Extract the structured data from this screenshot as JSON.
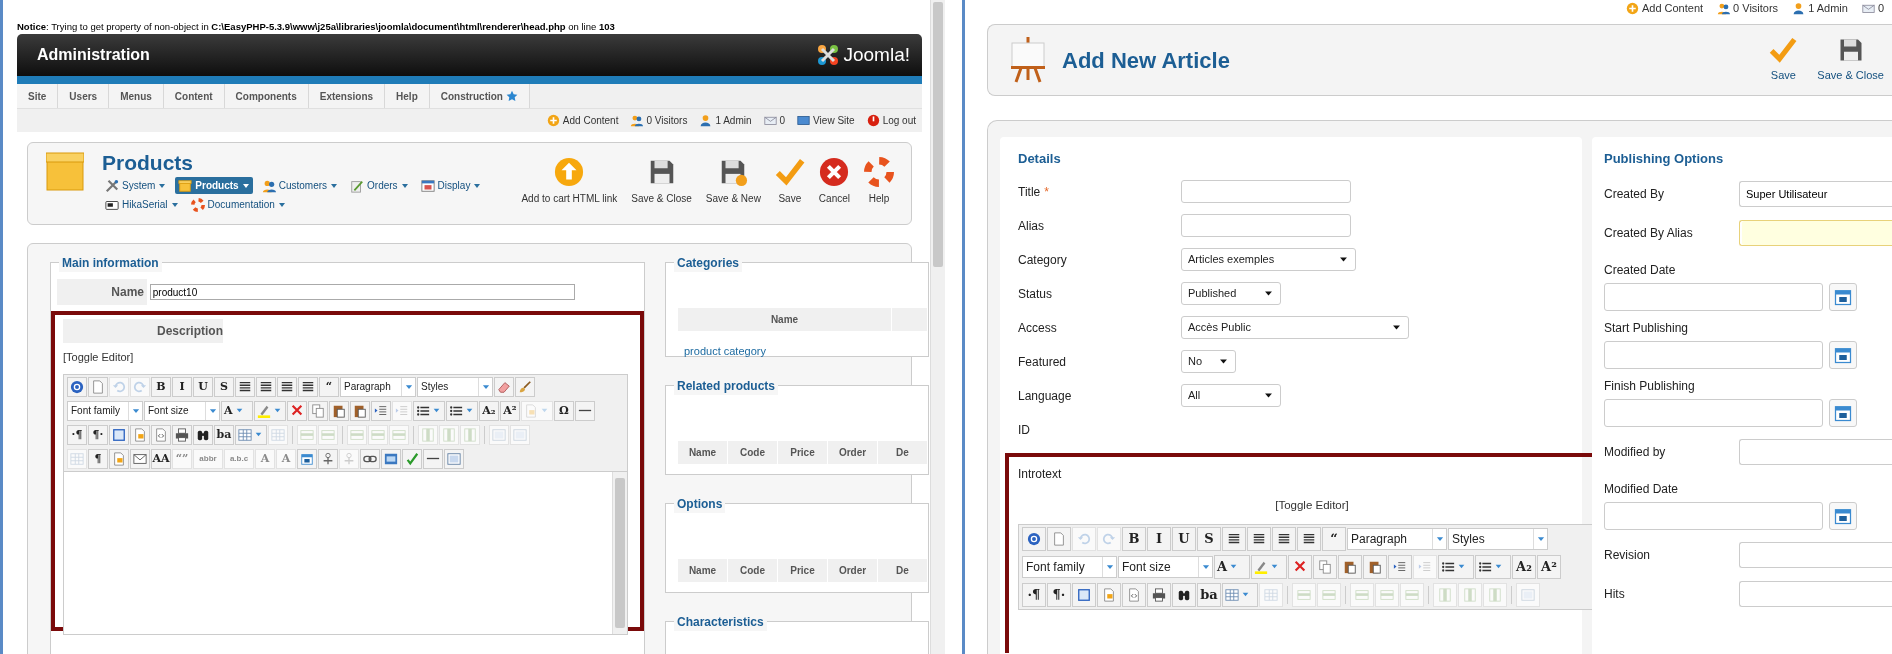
{
  "left": {
    "notice": "**Notice**: Trying to get property of non-object in **C:\\EasyPHP-5.3.9\\www\\j25a\\libraries\\joomla\\document\\html\\renderer\\head.php** on line **103**",
    "header": {
      "title": "Administration",
      "logo": "Joomla!"
    },
    "menu": [
      {
        "label": "Site",
        "starred": false
      },
      {
        "label": "Users",
        "starred": false
      },
      {
        "label": "Menus",
        "starred": false
      },
      {
        "label": "Content",
        "starred": false
      },
      {
        "label": "Components",
        "starred": false
      },
      {
        "label": "Extensions",
        "starred": false
      },
      {
        "label": "Help",
        "starred": false
      },
      {
        "label": "Construction",
        "starred": true
      }
    ],
    "status": [
      {
        "kind": "add",
        "label": "Add Content"
      },
      {
        "kind": "visitors",
        "label": "0 Visitors"
      },
      {
        "kind": "admin",
        "label": "1 Admin"
      },
      {
        "kind": "messages",
        "label": "0"
      },
      {
        "kind": "site",
        "label": "View Site"
      },
      {
        "kind": "logout",
        "label": "Log out"
      }
    ],
    "page_title": "Products",
    "submenu": [
      [
        {
          "kind": "tools",
          "label": "System",
          "selected": false
        },
        {
          "kind": "box",
          "label": "Products",
          "selected": true
        },
        {
          "kind": "people",
          "label": "Customers",
          "selected": false
        },
        {
          "kind": "pen",
          "label": "Orders",
          "selected": false
        },
        {
          "kind": "window",
          "label": "Display",
          "selected": false
        }
      ],
      [
        {
          "kind": "card",
          "label": "HikaSerial",
          "selected": false
        },
        {
          "kind": "lifebuoy",
          "label": "Documentation",
          "selected": false
        }
      ]
    ],
    "toolbar": [
      {
        "kind": "upload",
        "label": "Add to cart HTML link"
      },
      {
        "kind": "floppy",
        "label": "Save & Close"
      },
      {
        "kind": "floppy-plus",
        "label": "Save & New"
      },
      {
        "kind": "check",
        "label": "Save"
      },
      {
        "kind": "cancel",
        "label": "Cancel"
      },
      {
        "kind": "lifebuoy",
        "label": "Help"
      }
    ],
    "main": {
      "legend": "Main information",
      "name_label": "Name",
      "name_value": "product10",
      "description_label": "Description",
      "toggle": "[Toggle Editor]",
      "editor": [
        [
          {
            "kind": "help",
            "disabled": false
          },
          {
            "kind": "page",
            "disabled": false
          },
          {
            "kind": "undo",
            "disabled": true
          },
          {
            "kind": "redo",
            "disabled": true
          },
          {
            "kind": "glyph",
            "glyph": "B",
            "disabled": false
          },
          {
            "kind": "glyph",
            "glyph": "I",
            "disabled": false
          },
          {
            "kind": "glyph",
            "glyph": "U",
            "disabled": false
          },
          {
            "kind": "glyph",
            "glyph": "S",
            "disabled": false
          },
          {
            "kind": "align",
            "disabled": false
          },
          {
            "kind": "align",
            "disabled": false
          },
          {
            "kind": "align",
            "disabled": false
          },
          {
            "kind": "align",
            "disabled": false
          },
          {
            "kind": "glyph",
            "glyph": "“",
            "disabled": false
          },
          {
            "kind": "select",
            "value": "Paragraph",
            "disabled": false
          },
          {
            "kind": "select",
            "value": "Styles",
            "disabled": false
          },
          {
            "kind": "eraser",
            "disabled": false
          },
          {
            "kind": "brush",
            "disabled": false
          }
        ],
        [
          {
            "kind": "select",
            "value": "Font family",
            "disabled": false
          },
          {
            "kind": "select",
            "value": "Font size",
            "disabled": false
          },
          {
            "kind": "glyph",
            "glyph": "A",
            "dropdown": true,
            "disabled": false
          },
          {
            "kind": "highlight",
            "dropdown": true,
            "disabled": false
          },
          {
            "kind": "cut",
            "disabled": false
          },
          {
            "kind": "copy",
            "disabled": false
          },
          {
            "kind": "paste",
            "disabled": false
          },
          {
            "kind": "paste",
            "disabled": false
          },
          {
            "kind": "indent",
            "disabled": false
          },
          {
            "kind": "indent",
            "disabled": true
          },
          {
            "kind": "list",
            "dropdown": true,
            "disabled": false
          },
          {
            "kind": "list",
            "dropdown": true,
            "disabled": false
          },
          {
            "kind": "glyph",
            "glyph": "A₂",
            "disabled": false
          },
          {
            "kind": "glyph",
            "glyph": "A²",
            "disabled": false
          },
          {
            "kind": "template",
            "dropdown": true,
            "disabled": true
          },
          {
            "kind": "glyph",
            "glyph": "Ω",
            "disabled": false
          },
          {
            "kind": "rule",
            "disabled": false
          }
        ],
        [
          {
            "kind": "glyph",
            "glyph": "·¶",
            "disabled": false
          },
          {
            "kind": "glyph",
            "glyph": "¶·",
            "disabled": false
          },
          {
            "kind": "fullscreen",
            "disabled": false
          },
          {
            "kind": "template",
            "disabled": false
          },
          {
            "kind": "code",
            "disabled": false
          },
          {
            "kind": "print",
            "disabled": false
          },
          {
            "kind": "find",
            "disabled": false
          },
          {
            "kind": "glyph",
            "glyph": "ba",
            "disabled": false
          },
          {
            "kind": "table",
            "dropdown": true,
            "disabled": false
          },
          {
            "kind": "table",
            "disabled": true
          },
          {
            "kind": "sep"
          },
          {
            "kind": "row",
            "disabled": true
          },
          {
            "kind": "row",
            "disabled": true
          },
          {
            "kind": "sep"
          },
          {
            "kind": "row",
            "disabled": true
          },
          {
            "kind": "row",
            "disabled": true
          },
          {
            "kind": "row",
            "disabled": true
          },
          {
            "kind": "sep"
          },
          {
            "kind": "column",
            "disabled": true
          },
          {
            "kind": "column",
            "disabled": true
          },
          {
            "kind": "column",
            "disabled": true
          },
          {
            "kind": "sep"
          },
          {
            "kind": "frame",
            "disabled": true
          },
          {
            "kind": "frame",
            "disabled": true
          }
        ],
        [
          {
            "kind": "table",
            "disabled": true
          },
          {
            "kind": "glyph",
            "glyph": "¶",
            "disabled": false
          },
          {
            "kind": "template",
            "disabled": false
          },
          {
            "kind": "mail",
            "disabled": false
          },
          {
            "kind": "glyph",
            "glyph": "AA",
            "disabled": false
          },
          {
            "kind": "glyph",
            "glyph": "“”",
            "disabled": true
          },
          {
            "kind": "glyph",
            "glyph": "abbr",
            "disabled": true
          },
          {
            "kind": "glyph",
            "glyph": "a.b.c",
            "disabled": true
          },
          {
            "kind": "glyph",
            "glyph": "A",
            "disabled": true
          },
          {
            "kind": "glyph",
            "glyph": "A",
            "disabled": true
          },
          {
            "kind": "calendar",
            "disabled": false
          },
          {
            "kind": "anchor",
            "disabled": false
          },
          {
            "kind": "anchor",
            "disabled": true
          },
          {
            "kind": "link",
            "disabled": false
          },
          {
            "kind": "image",
            "disabled": false
          },
          {
            "kind": "spell",
            "disabled": false
          },
          {
            "kind": "rule",
            "disabled": false
          },
          {
            "kind": "frame",
            "disabled": false
          }
        ]
      ]
    },
    "categories": {
      "legend": "Categories",
      "columns": [
        "Name"
      ],
      "rows": [
        "product category"
      ]
    },
    "related": {
      "legend": "Related products",
      "columns": [
        "Name",
        "Code",
        "Price",
        "Order",
        "De"
      ]
    },
    "options": {
      "legend": "Options",
      "columns": [
        "Name",
        "Code",
        "Price",
        "Order",
        "De"
      ]
    },
    "characteristics": {
      "legend": "Characteristics"
    }
  },
  "right": {
    "status": [
      {
        "kind": "add",
        "label": "Add Content"
      },
      {
        "kind": "visitors",
        "label": "0 Visitors"
      },
      {
        "kind": "admin",
        "label": "1 Admin"
      },
      {
        "kind": "messages",
        "label": "0"
      }
    ],
    "title": "Add New Article",
    "toolbar": [
      {
        "kind": "check",
        "label": "Save"
      },
      {
        "kind": "floppy",
        "label": "Save & Close"
      }
    ],
    "details": {
      "legend": "Details",
      "fields": [
        {
          "kind": "text",
          "label": "Title",
          "required_mark": "*"
        },
        {
          "kind": "text",
          "label": "Alias"
        },
        {
          "kind": "select",
          "label": "Category",
          "value": "Articles exemples"
        },
        {
          "kind": "select",
          "label": "Status",
          "value": "Published"
        },
        {
          "kind": "select",
          "label": "Access",
          "value": "Accès Public"
        },
        {
          "kind": "select",
          "label": "Featured",
          "value": "No"
        },
        {
          "kind": "select",
          "label": "Language",
          "value": "All"
        },
        {
          "kind": "static",
          "label": "ID"
        }
      ],
      "introtext_label": "Introtext",
      "toggle": "[Toggle Editor]",
      "editor": [
        [
          {
            "kind": "help",
            "disabled": false
          },
          {
            "kind": "page",
            "disabled": false
          },
          {
            "kind": "undo",
            "disabled": true
          },
          {
            "kind": "redo",
            "disabled": true
          },
          {
            "kind": "glyph",
            "glyph": "B",
            "disabled": false
          },
          {
            "kind": "glyph",
            "glyph": "I",
            "disabled": false
          },
          {
            "kind": "glyph",
            "glyph": "U",
            "disabled": false
          },
          {
            "kind": "glyph",
            "glyph": "S",
            "disabled": false
          },
          {
            "kind": "align",
            "disabled": false
          },
          {
            "kind": "align",
            "disabled": false
          },
          {
            "kind": "align",
            "disabled": false
          },
          {
            "kind": "align",
            "disabled": false
          },
          {
            "kind": "glyph",
            "glyph": "“",
            "disabled": false
          },
          {
            "kind": "select",
            "value": "Paragraph",
            "disabled": false
          },
          {
            "kind": "select",
            "value": "Styles",
            "disabled": false
          }
        ],
        [
          {
            "kind": "select",
            "value": "Font family",
            "disabled": false
          },
          {
            "kind": "select",
            "value": "Font size",
            "disabled": false
          },
          {
            "kind": "glyph",
            "glyph": "A",
            "dropdown": true,
            "disabled": false
          },
          {
            "kind": "highlight",
            "dropdown": true,
            "disabled": false
          },
          {
            "kind": "cut",
            "disabled": false
          },
          {
            "kind": "copy",
            "disabled": false
          },
          {
            "kind": "paste",
            "disabled": false
          },
          {
            "kind": "paste",
            "disabled": false
          },
          {
            "kind": "indent",
            "disabled": false
          },
          {
            "kind": "indent",
            "disabled": true
          },
          {
            "kind": "list",
            "dropdown": true,
            "disabled": false
          },
          {
            "kind": "list",
            "dropdown": true,
            "disabled": false
          },
          {
            "kind": "glyph",
            "glyph": "A₂",
            "disabled": false
          },
          {
            "kind": "glyph",
            "glyph": "A²",
            "disabled": false
          }
        ],
        [
          {
            "kind": "glyph",
            "glyph": "·¶",
            "disabled": false
          },
          {
            "kind": "glyph",
            "glyph": "¶·",
            "disabled": false
          },
          {
            "kind": "fullscreen",
            "disabled": false
          },
          {
            "kind": "template",
            "disabled": false
          },
          {
            "kind": "code",
            "disabled": false
          },
          {
            "kind": "print",
            "disabled": false
          },
          {
            "kind": "find",
            "disabled": false
          },
          {
            "kind": "glyph",
            "glyph": "ba",
            "disabled": false
          },
          {
            "kind": "table",
            "dropdown": true,
            "disabled": false
          },
          {
            "kind": "table",
            "disabled": true
          },
          {
            "kind": "sep"
          },
          {
            "kind": "row",
            "disabled": true
          },
          {
            "kind": "row",
            "disabled": true
          },
          {
            "kind": "sep"
          },
          {
            "kind": "row",
            "disabled": true
          },
          {
            "kind": "row",
            "disabled": true
          },
          {
            "kind": "row",
            "disabled": true
          },
          {
            "kind": "sep"
          },
          {
            "kind": "column",
            "disabled": true
          },
          {
            "kind": "column",
            "disabled": true
          },
          {
            "kind": "column",
            "disabled": true
          },
          {
            "kind": "sep"
          },
          {
            "kind": "frame",
            "disabled": true
          }
        ]
      ]
    },
    "publishing": {
      "legend": "Publishing Options",
      "fields": [
        {
          "kind": "inline",
          "label": "Created By",
          "value": "Super Utilisateur",
          "focused": false
        },
        {
          "kind": "inline",
          "label": "Created By Alias",
          "focused": true
        },
        {
          "kind": "date",
          "label": "Created Date"
        },
        {
          "kind": "date",
          "label": "Start Publishing"
        },
        {
          "kind": "date",
          "label": "Finish Publishing"
        },
        {
          "kind": "inline",
          "label": "Modified by",
          "focused": false
        },
        {
          "kind": "date",
          "label": "Modified Date"
        },
        {
          "kind": "inline",
          "label": "Revision",
          "focused": false
        },
        {
          "kind": "inline",
          "label": "Hits",
          "focused": false
        }
      ]
    }
  }
}
